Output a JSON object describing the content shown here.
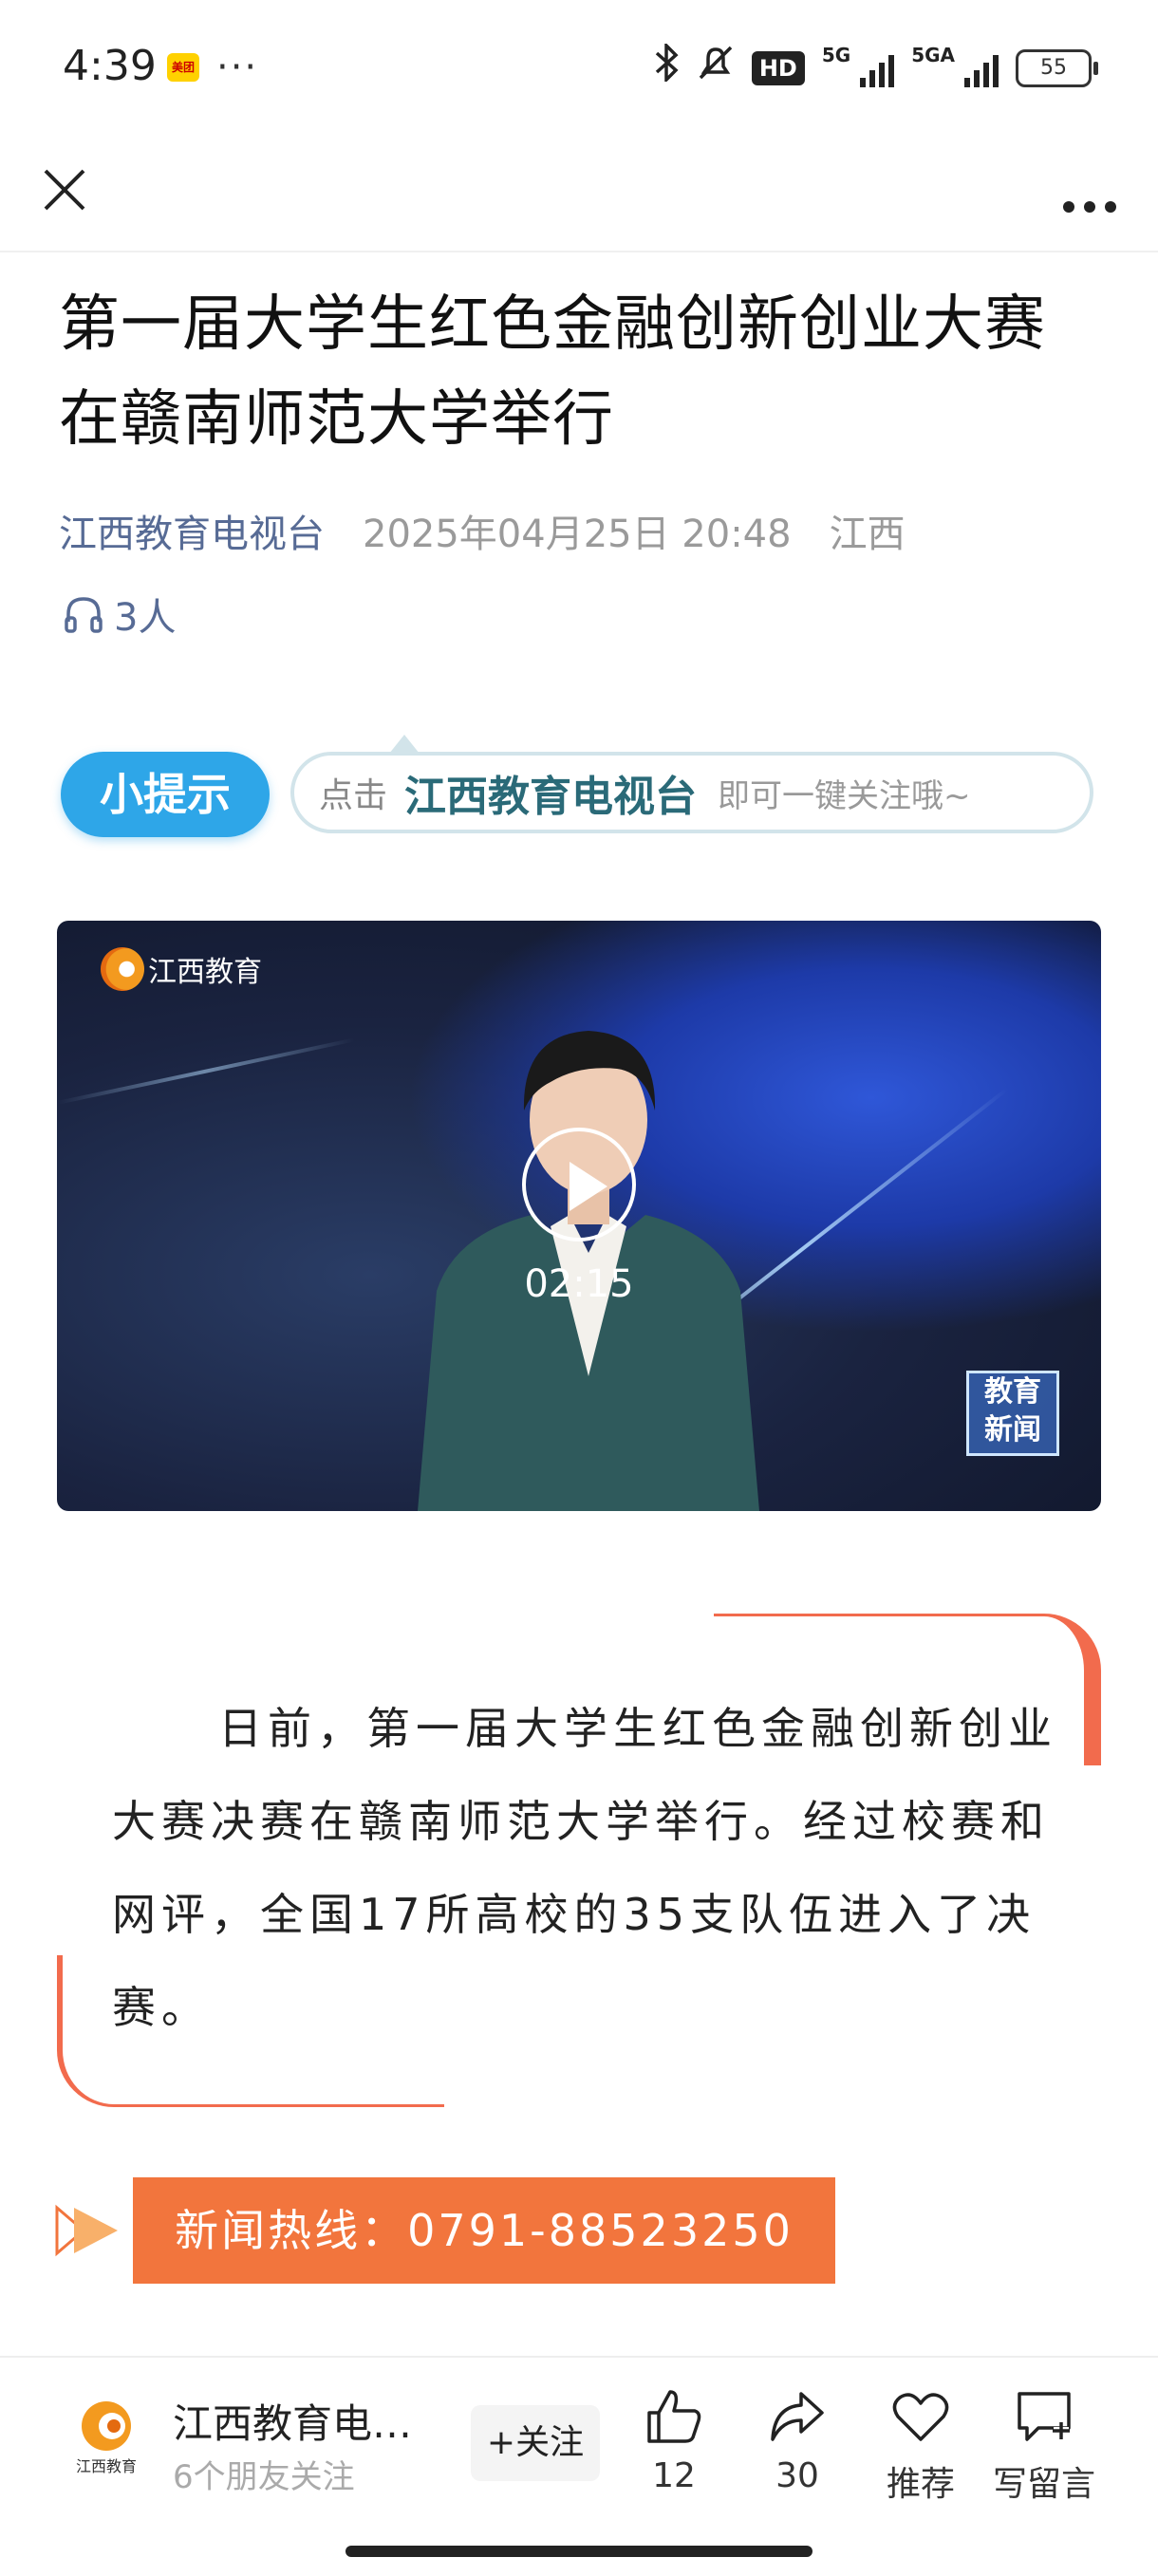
{
  "status_bar": {
    "time": "4:39",
    "app_badge": "美团",
    "network_hd": "HD",
    "network_1": "5G",
    "network_2": "5GA",
    "battery": "55"
  },
  "article": {
    "title": "第一届大学生红色金融创新创业大赛在赣南师范大学举行",
    "source": "江西教育电视台",
    "date": "2025年04月25日 20:48",
    "region": "江西",
    "listeners": "3人"
  },
  "tip": {
    "label": "小提示",
    "prefix": "点击",
    "name": "江西教育电视台",
    "suffix": "即可一键关注哦~"
  },
  "video": {
    "channel": "江西教育",
    "news_badge_line1": "教育",
    "news_badge_line2": "新闻",
    "duration": "02:15"
  },
  "body": {
    "paragraph": "日前，第一届大学生红色金融创新创业大赛决赛在赣南师范大学举行。经过校赛和网评，全国17所高校的35支队伍进入了决赛。"
  },
  "hotline": {
    "text": "新闻热线：0791-88523250"
  },
  "bottom_bar": {
    "account_name": "江西教育电…",
    "logo_text": "江西教育",
    "followers": "6个朋友关注",
    "follow_label": "+关注",
    "like_count": "12",
    "share_count": "30",
    "recommend_label": "推荐",
    "comment_label": "写留言"
  },
  "colors": {
    "accent_link": "#576b95",
    "quote_border": "#f26b4d",
    "hotline_bg": "#f2753d",
    "tip_blue": "#2ea6e8"
  }
}
